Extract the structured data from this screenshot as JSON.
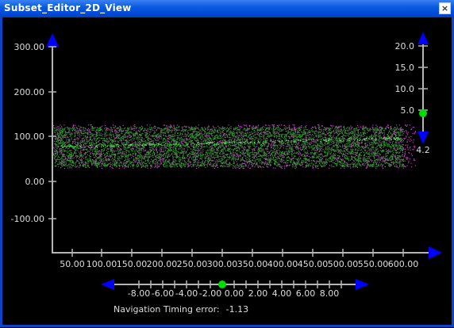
{
  "window": {
    "title": "Subset_Editor_2D_View",
    "close_glyph": "×"
  },
  "plot": {
    "y_ticks": [
      "300.00",
      "200.00",
      "100.00",
      "0.00",
      "-100.00"
    ],
    "x_ticks": [
      "50.00",
      "100.00",
      "150.00",
      "200.00",
      "250.00",
      "300.00",
      "350.00",
      "400.00",
      "450.00",
      "500.00",
      "550.00",
      "600.00"
    ]
  },
  "zoom_slider": {
    "ticks": [
      "20.0",
      "15.0",
      "10.0",
      "5.0"
    ],
    "value_label": "4.2"
  },
  "timing_slider": {
    "ticks": [
      "-8.00",
      "-6.00",
      "-4.00",
      "-2.00",
      "0.00",
      "2.00",
      "4.00",
      "6.00",
      "8.00"
    ],
    "label": "Navigation Timing error:",
    "value": "-1.13"
  },
  "colors": {
    "axis": "#b5b5b5",
    "arrow": "#0000ff",
    "knob": "#00dd00",
    "green_points": "#2e9b2e",
    "magenta_points": "#c040c0"
  }
}
